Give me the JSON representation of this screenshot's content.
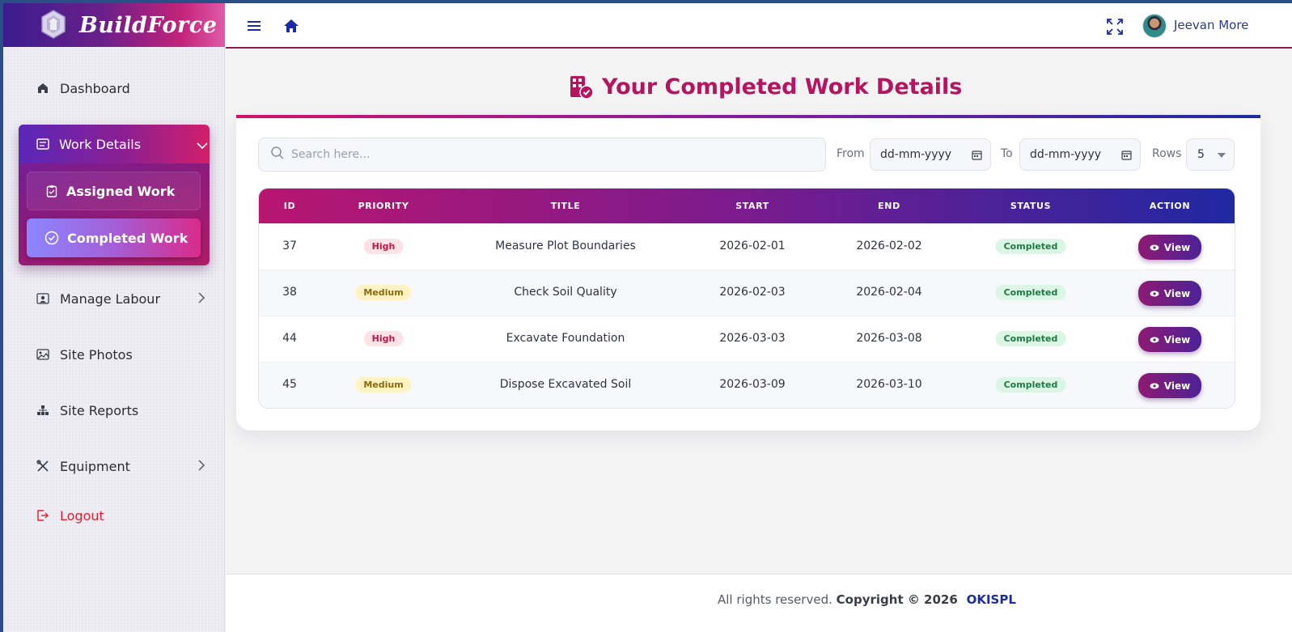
{
  "brand": {
    "name": "BuildForce"
  },
  "sidebar": {
    "items": [
      {
        "label": "Dashboard"
      },
      {
        "label": "Work Details"
      },
      {
        "label": "Assigned Work"
      },
      {
        "label": "Completed Work"
      },
      {
        "label": "Manage Labour"
      },
      {
        "label": "Site Photos"
      },
      {
        "label": "Site Reports"
      },
      {
        "label": "Equipment"
      },
      {
        "label": "Logout"
      }
    ]
  },
  "topbar": {
    "user_name": "Jeevan More"
  },
  "page": {
    "title": "Your Completed Work Details"
  },
  "filters": {
    "search_placeholder": "Search here...",
    "from_label": "From",
    "from_value": "dd-mm-yyyy",
    "to_label": "To",
    "to_value": "dd-mm-yyyy",
    "rows_label": "Rows",
    "rows_value": "5"
  },
  "table": {
    "headers": [
      "ID",
      "PRIORITY",
      "TITLE",
      "START",
      "END",
      "STATUS",
      "ACTION"
    ],
    "rows": [
      {
        "id": "37",
        "priority": "High",
        "title": "Measure Plot Boundaries",
        "start": "2026-02-01",
        "end": "2026-02-02",
        "status": "Completed",
        "action": "View"
      },
      {
        "id": "38",
        "priority": "Medium",
        "title": "Check Soil Quality",
        "start": "2026-02-03",
        "end": "2026-02-04",
        "status": "Completed",
        "action": "View"
      },
      {
        "id": "44",
        "priority": "High",
        "title": "Excavate Foundation",
        "start": "2026-03-03",
        "end": "2026-03-08",
        "status": "Completed",
        "action": "View"
      },
      {
        "id": "45",
        "priority": "Medium",
        "title": "Dispose Excavated Soil",
        "start": "2026-03-09",
        "end": "2026-03-10",
        "status": "Completed",
        "action": "View"
      }
    ]
  },
  "footer": {
    "text": "All rights reserved.",
    "copyright": "Copyright © 2026",
    "company": "OKISPL"
  },
  "colors": {
    "accent": "#b5145f",
    "navy": "#1c2ba0",
    "logout": "#e0202f"
  }
}
